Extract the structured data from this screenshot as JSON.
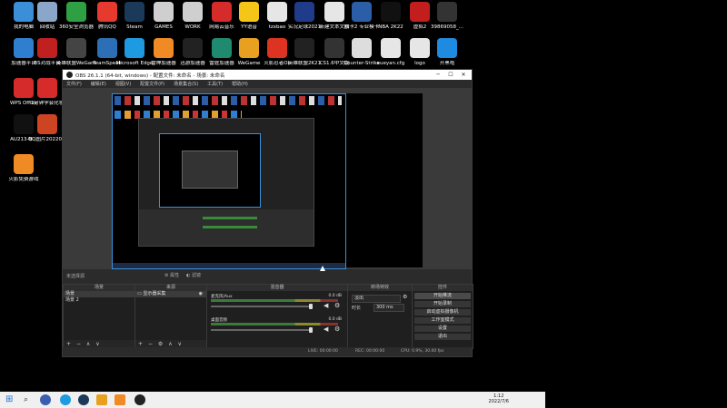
{
  "desktop": {
    "icons": [
      {
        "label": "我的电脑",
        "color": "#3a8fd8",
        "icon": "computer-icon"
      },
      {
        "label": "回收站",
        "color": "#8aa6c8",
        "icon": "recycle-bin-icon"
      },
      {
        "label": "360安全浏览器",
        "color": "#2ea043",
        "icon": "browser-icon"
      },
      {
        "label": "腾讯QQ",
        "color": "#e63a2e",
        "icon": "qq-icon"
      },
      {
        "label": "Steam",
        "color": "#1b3a5a",
        "icon": "steam-icon"
      },
      {
        "label": "GAMES",
        "color": "#cfcfcf",
        "icon": "folder-icon"
      },
      {
        "label": "WORK",
        "color": "#cfcfcf",
        "icon": "folder-icon"
      },
      {
        "label": "网易云音乐",
        "color": "#d62b2b",
        "icon": "music-icon"
      },
      {
        "label": "YY语音",
        "color": "#f5c518",
        "icon": "yy-icon"
      },
      {
        "label": "tzxbao",
        "color": "#e6e6e6",
        "icon": "file-icon"
      },
      {
        "label": "实况足球2021",
        "color": "#1f3c8a",
        "icon": "game-icon"
      },
      {
        "label": "新建文本文档",
        "color": "#e6e6e6",
        "icon": "text-file-icon"
      },
      {
        "label": "欧卡2 专业模卡",
        "color": "#2c5ea8",
        "icon": "game-icon"
      },
      {
        "label": "NBA 2K22",
        "color": "#111111",
        "icon": "game-icon"
      },
      {
        "label": "虚拟2",
        "color": "#c21e1e",
        "icon": "app-icon"
      },
      {
        "label": "39869058_...",
        "color": "#333333",
        "icon": "image-icon"
      },
      {
        "label": "加速器平台",
        "color": "#2f7fd0",
        "icon": "app-icon"
      },
      {
        "label": "BS对战平台",
        "color": "#c02020",
        "icon": "app-icon"
      },
      {
        "label": "英雄联盟WeGame",
        "color": "#444444",
        "icon": "game-icon"
      },
      {
        "label": "TeamSpeak",
        "color": "#2c6fb4",
        "icon": "teamspeak-icon"
      },
      {
        "label": "Microsoft Edge",
        "color": "#1e9be0",
        "icon": "edge-icon"
      },
      {
        "label": "雷神加速器",
        "color": "#f08a24",
        "icon": "app-icon"
      },
      {
        "label": "迅游加速器",
        "color": "#222222",
        "icon": "app-icon"
      },
      {
        "label": "雷霆加速器",
        "color": "#1f8a70",
        "icon": "app-icon"
      },
      {
        "label": "WeGame",
        "color": "#e8a020",
        "icon": "wegame-icon"
      },
      {
        "label": "火影忍者OL",
        "color": "#dd3322",
        "icon": "game-icon"
      },
      {
        "label": "英雄联盟2K21",
        "color": "#222222",
        "icon": "game-icon"
      },
      {
        "label": "CS1.6中文版",
        "color": "#333333",
        "icon": "cs-icon"
      },
      {
        "label": "Counter-Strike",
        "color": "#dddddd",
        "icon": "cs-icon"
      },
      {
        "label": "xueyan.cfg",
        "color": "#e6e6e6",
        "icon": "file-icon"
      },
      {
        "label": "logo",
        "color": "#e6e6e6",
        "icon": "image-icon"
      },
      {
        "label": "开黑啦",
        "color": "#1e8be0",
        "icon": "app-icon"
      },
      {
        "label": "WPS Office",
        "color": "#d62b2b",
        "icon": "wps-icon"
      },
      {
        "label": "3分钟学会化妆",
        "color": "#d62b2b",
        "icon": "app-icon"
      },
      {
        "label": "AU213-N...",
        "color": "#111111",
        "icon": "file-icon"
      },
      {
        "label": "QQ图片20220...",
        "color": "#cc4422",
        "icon": "image-icon"
      },
      {
        "label": "火影免费游戏",
        "color": "#f08a24",
        "icon": "game-icon"
      }
    ]
  },
  "obs": {
    "title": "OBS 26.1.1 (64-bit, windows) - 配置文件: 未命名 - 场景: 未命名",
    "menu": [
      "文件(F)",
      "编辑(E)",
      "视图(V)",
      "配置文件(P)",
      "场景集合(S)",
      "工具(T)",
      "帮助(H)"
    ],
    "mode_label": "未选择源",
    "props_label": "属性",
    "filters_label": "滤镜",
    "panels": {
      "scenes": {
        "title": "场景",
        "items": [
          "场景",
          "场景 2"
        ]
      },
      "sources": {
        "title": "来源",
        "items": [
          "显示器采集"
        ]
      },
      "mixer": {
        "title": "混音器",
        "tracks": [
          {
            "name": "桌面音频",
            "db": "0.0 dB",
            "level": 0.85
          },
          {
            "name": "麦克风/Aux",
            "db": "0.0 dB",
            "level": 0.8
          }
        ]
      },
      "transitions": {
        "title": "转场特效",
        "type": "淡出",
        "duration_label": "时长",
        "duration": "300 ms"
      },
      "controls": {
        "title": "控件",
        "buttons": [
          "开始推流",
          "开始录制",
          "启动虚拟摄像机",
          "工作室模式",
          "设置",
          "退出"
        ]
      }
    },
    "status": {
      "live": "LIVE: 00:00:00",
      "rec": "REC: 00:00:00",
      "cpu": "CPU: 0.9%, 30.00 fps"
    }
  },
  "taskbar": {
    "time": "1:12",
    "date": "2022/7/6"
  }
}
